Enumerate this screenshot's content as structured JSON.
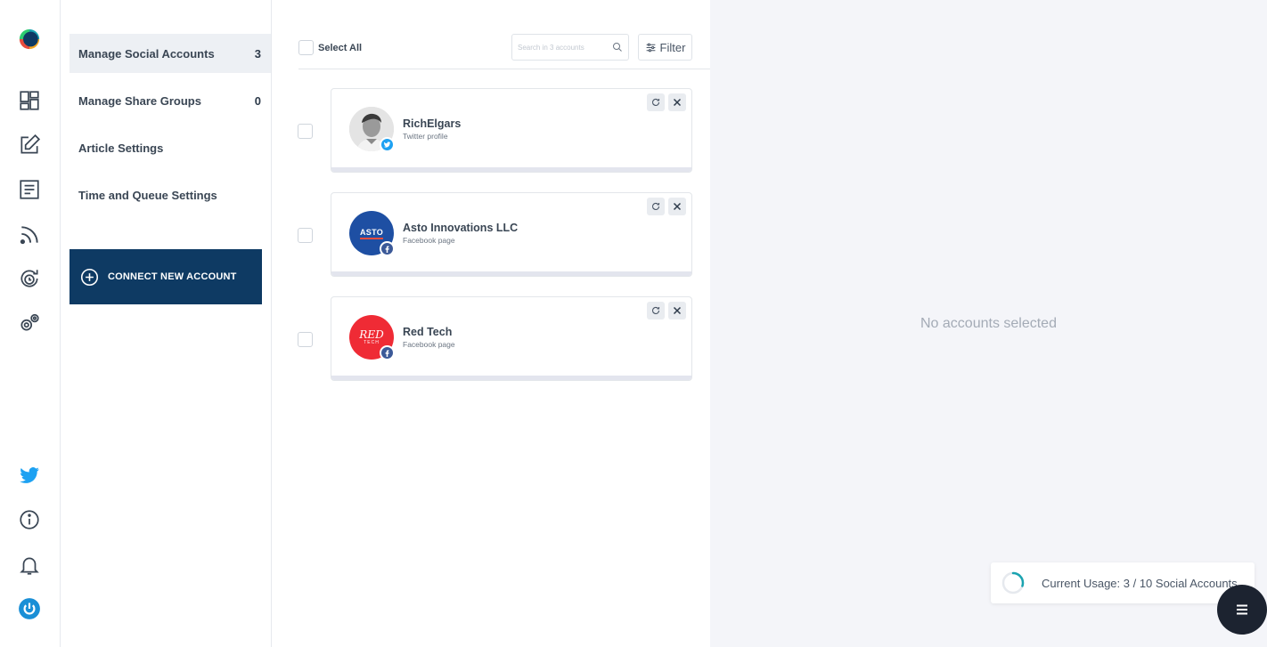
{
  "rail": {
    "icons": [
      "logo-icon",
      "dashboard-icon",
      "compose-icon",
      "articles-icon",
      "rss-icon",
      "schedule-icon",
      "settings-icon",
      "twitter-icon",
      "info-icon",
      "bell-icon",
      "power-icon"
    ]
  },
  "menu": {
    "items": [
      {
        "label": "Manage Social Accounts",
        "count": "3"
      },
      {
        "label": "Manage Share Groups",
        "count": "0"
      },
      {
        "label": "Article Settings",
        "count": ""
      },
      {
        "label": "Time and Queue Settings",
        "count": ""
      }
    ],
    "connect_label": "CONNECT NEW ACCOUNT"
  },
  "toolbar": {
    "select_all": "Select All",
    "search_placeholder": "Search in 3 accounts",
    "filter_label": "Filter"
  },
  "accounts": [
    {
      "name": "RichElgars",
      "type": "Twitter profile",
      "network": "twitter"
    },
    {
      "name": "Asto Innovations LLC",
      "type": "Facebook page",
      "network": "facebook",
      "logo_text": "ASTO"
    },
    {
      "name": "Red Tech",
      "type": "Facebook page",
      "network": "facebook",
      "logo_text": "RED",
      "logo_sub": "TECH"
    }
  ],
  "detail": {
    "empty_text": "No accounts selected",
    "usage_text": "Current Usage: 3 / 10 Social Accounts",
    "usage_fraction": 0.3
  },
  "colors": {
    "brand_navy": "#0e3a63",
    "twitter": "#1da1f2",
    "facebook": "#3b5998",
    "asto_blue": "#1e4fa3",
    "red_tech": "#ef2b35",
    "arrow": "#f05a5a",
    "teal": "#1aa3b0"
  }
}
